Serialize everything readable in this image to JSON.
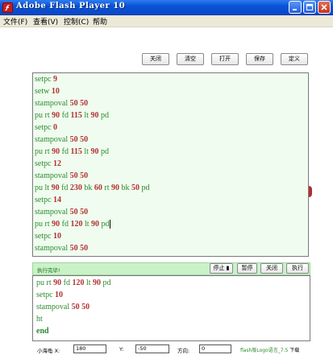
{
  "window": {
    "title": "Adobe Flash Player 10",
    "controls": {
      "minimize": "minimize-icon",
      "maximize": "maximize-icon",
      "close": "close-icon"
    }
  },
  "menu": [
    {
      "label": "文件(F)"
    },
    {
      "label": "查看(V)"
    },
    {
      "label": "控制(C)"
    },
    {
      "label": "帮助"
    }
  ],
  "toolbar": {
    "close_label": "关闭",
    "clear_label": "清空",
    "open_label": "打开",
    "save_label": "保存",
    "define_label": "定义"
  },
  "editor": {
    "lines": [
      [
        {
          "t": "setpc ",
          "c": "cmd"
        },
        {
          "t": "9",
          "c": "num"
        }
      ],
      [
        {
          "t": "setw ",
          "c": "cmd"
        },
        {
          "t": "10",
          "c": "num"
        }
      ],
      [
        {
          "t": "stampoval ",
          "c": "cmd"
        },
        {
          "t": "50 50",
          "c": "num"
        }
      ],
      [
        {
          "t": "pu rt ",
          "c": "cmd"
        },
        {
          "t": "90",
          "c": "num"
        },
        {
          "t": " fd ",
          "c": "cmd"
        },
        {
          "t": "115",
          "c": "num"
        },
        {
          "t": " lt ",
          "c": "cmd"
        },
        {
          "t": "90",
          "c": "num"
        },
        {
          "t": " pd",
          "c": "cmd"
        }
      ],
      [
        {
          "t": "setpc ",
          "c": "cmd"
        },
        {
          "t": "0",
          "c": "num"
        }
      ],
      [
        {
          "t": "stampoval ",
          "c": "cmd"
        },
        {
          "t": "50 50",
          "c": "num"
        }
      ],
      [
        {
          "t": "pu rt ",
          "c": "cmd"
        },
        {
          "t": "90",
          "c": "num"
        },
        {
          "t": " fd ",
          "c": "cmd"
        },
        {
          "t": "115",
          "c": "num"
        },
        {
          "t": " lt ",
          "c": "cmd"
        },
        {
          "t": "90",
          "c": "num"
        },
        {
          "t": " pd",
          "c": "cmd"
        }
      ],
      [
        {
          "t": "setpc ",
          "c": "cmd"
        },
        {
          "t": "12",
          "c": "num"
        }
      ],
      [
        {
          "t": "stampoval ",
          "c": "cmd"
        },
        {
          "t": "50 50",
          "c": "num"
        }
      ],
      [
        {
          "t": "pu lt ",
          "c": "cmd"
        },
        {
          "t": "90",
          "c": "num"
        },
        {
          "t": " fd ",
          "c": "cmd"
        },
        {
          "t": "230",
          "c": "num"
        },
        {
          "t": " bk ",
          "c": "cmd"
        },
        {
          "t": "60",
          "c": "num"
        },
        {
          "t": " rt ",
          "c": "cmd"
        },
        {
          "t": "90",
          "c": "num"
        },
        {
          "t": " bk ",
          "c": "cmd"
        },
        {
          "t": "50",
          "c": "num"
        },
        {
          "t": " pd",
          "c": "cmd"
        }
      ],
      [
        {
          "t": "setpc ",
          "c": "cmd"
        },
        {
          "t": "14",
          "c": "num"
        }
      ],
      [
        {
          "t": "stampoval ",
          "c": "cmd"
        },
        {
          "t": "50 50",
          "c": "num"
        }
      ],
      [
        {
          "t": "pu rt ",
          "c": "cmd"
        },
        {
          "t": "90",
          "c": "num"
        },
        {
          "t": " fd ",
          "c": "cmd"
        },
        {
          "t": "120",
          "c": "num"
        },
        {
          "t": " lt ",
          "c": "cmd"
        },
        {
          "t": "90",
          "c": "num"
        },
        {
          "t": " pd",
          "c": "cmd"
        }
      ],
      [
        {
          "t": "setpc ",
          "c": "cmd"
        },
        {
          "t": "10",
          "c": "num"
        }
      ],
      [
        {
          "t": "stampoval ",
          "c": "cmd"
        },
        {
          "t": "50 50",
          "c": "num"
        }
      ]
    ]
  },
  "status": {
    "text": "执行完毕!",
    "stop_label": "停止 ▮",
    "pause_label": "暂停",
    "close_label": "关闭",
    "run_label": "执行"
  },
  "console": {
    "lines": [
      [
        {
          "t": "pu rt ",
          "c": "cmd"
        },
        {
          "t": "90",
          "c": "num"
        },
        {
          "t": " fd ",
          "c": "cmd"
        },
        {
          "t": "120",
          "c": "num"
        },
        {
          "t": " lt ",
          "c": "cmd"
        },
        {
          "t": "90",
          "c": "num"
        },
        {
          "t": " pd",
          "c": "cmd"
        }
      ],
      [
        {
          "t": "setpc ",
          "c": "cmd"
        },
        {
          "t": "10",
          "c": "num"
        }
      ],
      [
        {
          "t": "stampoval ",
          "c": "cmd"
        },
        {
          "t": "50 50",
          "c": "num"
        }
      ],
      [
        {
          "t": "ht",
          "c": "cmd"
        }
      ],
      [
        {
          "t": "end",
          "c": "cmd-bold"
        }
      ]
    ]
  },
  "coords": {
    "x_label": "小海龟 X:",
    "x_value": "180",
    "y_label": "Y:",
    "y_value": "-50",
    "dir_label": "方向:",
    "dir_value": "0"
  },
  "credit": {
    "name": "flash版Logo语言_7.5",
    "download": "下载"
  },
  "colors": {
    "command": "#2d8a2d",
    "number": "#b23232",
    "editor_bg": "#effcef",
    "status_bg": "#c9f2c9",
    "titlebar": "#0a54d8"
  }
}
